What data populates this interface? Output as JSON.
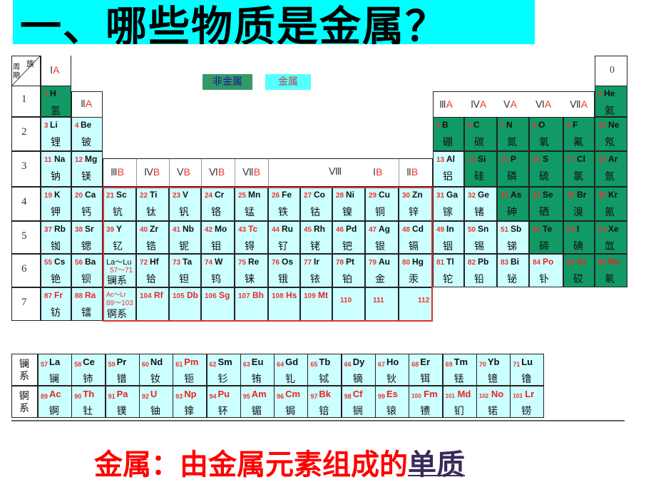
{
  "title": "一、哪些物质是金属？",
  "legend": {
    "nonmetal": "非金属",
    "metal": "金属"
  },
  "colors": {
    "nonmetal": "#119966",
    "metal": "#ccffff",
    "title_bg": "#00ffff",
    "footer": "#ff0000"
  },
  "header": {
    "group": "族",
    "period": "周期"
  },
  "groups_a": [
    {
      "roman": "Ⅰ",
      "suffix": "A"
    },
    {
      "roman": "Ⅱ",
      "suffix": "A"
    },
    {
      "roman": "Ⅲ",
      "suffix": "A"
    },
    {
      "roman": "Ⅳ",
      "suffix": "A"
    },
    {
      "roman": "Ⅴ",
      "suffix": "A"
    },
    {
      "roman": "Ⅵ",
      "suffix": "A"
    },
    {
      "roman": "Ⅶ",
      "suffix": "A"
    },
    {
      "roman": "0",
      "suffix": ""
    }
  ],
  "groups_b": [
    {
      "roman": "Ⅲ",
      "suffix": "B"
    },
    {
      "roman": "Ⅳ",
      "suffix": "B"
    },
    {
      "roman": "Ⅴ",
      "suffix": "B"
    },
    {
      "roman": "Ⅵ",
      "suffix": "B"
    },
    {
      "roman": "Ⅶ",
      "suffix": "B"
    },
    {
      "roman": "Ⅷ",
      "suffix": ""
    },
    {
      "roman": "Ⅰ",
      "suffix": "B"
    },
    {
      "roman": "Ⅱ",
      "suffix": "B"
    }
  ],
  "periods": [
    "1",
    "2",
    "3",
    "4",
    "5",
    "6",
    "7"
  ],
  "elements": [
    {
      "n": "1",
      "s": "H",
      "c": "氢",
      "p": 1,
      "g": 1,
      "nm": true
    },
    {
      "n": "2",
      "s": "He",
      "c": "氦",
      "p": 1,
      "g": 18,
      "nm": true
    },
    {
      "n": "3",
      "s": "Li",
      "c": "锂",
      "p": 2,
      "g": 1
    },
    {
      "n": "4",
      "s": "Be",
      "c": "铍",
      "p": 2,
      "g": 2
    },
    {
      "n": "5",
      "s": "B",
      "c": "硼",
      "p": 2,
      "g": 13,
      "nm": true
    },
    {
      "n": "6",
      "s": "C",
      "c": "碳",
      "p": 2,
      "g": 14,
      "nm": true
    },
    {
      "n": "7",
      "s": "N",
      "c": "氮",
      "p": 2,
      "g": 15,
      "nm": true
    },
    {
      "n": "8",
      "s": "O",
      "c": "氧",
      "p": 2,
      "g": 16,
      "nm": true
    },
    {
      "n": "9",
      "s": "F",
      "c": "氟",
      "p": 2,
      "g": 17,
      "nm": true
    },
    {
      "n": "10",
      "s": "Ne",
      "c": "氖",
      "p": 2,
      "g": 18,
      "nm": true
    },
    {
      "n": "11",
      "s": "Na",
      "c": "钠",
      "p": 3,
      "g": 1
    },
    {
      "n": "12",
      "s": "Mg",
      "c": "镁",
      "p": 3,
      "g": 2
    },
    {
      "n": "13",
      "s": "Al",
      "c": "铝",
      "p": 3,
      "g": 13
    },
    {
      "n": "14",
      "s": "Si",
      "c": "硅",
      "p": 3,
      "g": 14,
      "nm": true
    },
    {
      "n": "15",
      "s": "P",
      "c": "磷",
      "p": 3,
      "g": 15,
      "nm": true
    },
    {
      "n": "16",
      "s": "S",
      "c": "硫",
      "p": 3,
      "g": 16,
      "nm": true
    },
    {
      "n": "17",
      "s": "Cl",
      "c": "氯",
      "p": 3,
      "g": 17,
      "nm": true
    },
    {
      "n": "18",
      "s": "Ar",
      "c": "氩",
      "p": 3,
      "g": 18,
      "nm": true
    },
    {
      "n": "19",
      "s": "K",
      "c": "钾",
      "p": 4,
      "g": 1
    },
    {
      "n": "20",
      "s": "Ca",
      "c": "钙",
      "p": 4,
      "g": 2
    },
    {
      "n": "21",
      "s": "Sc",
      "c": "钪",
      "p": 4,
      "g": 3
    },
    {
      "n": "22",
      "s": "Ti",
      "c": "钛",
      "p": 4,
      "g": 4
    },
    {
      "n": "23",
      "s": "V",
      "c": "钒",
      "p": 4,
      "g": 5
    },
    {
      "n": "24",
      "s": "Cr",
      "c": "铬",
      "p": 4,
      "g": 6
    },
    {
      "n": "25",
      "s": "Mn",
      "c": "锰",
      "p": 4,
      "g": 7
    },
    {
      "n": "26",
      "s": "Fe",
      "c": "铁",
      "p": 4,
      "g": 8
    },
    {
      "n": "27",
      "s": "Co",
      "c": "钴",
      "p": 4,
      "g": 9
    },
    {
      "n": "28",
      "s": "Ni",
      "c": "镍",
      "p": 4,
      "g": 10
    },
    {
      "n": "29",
      "s": "Cu",
      "c": "铜",
      "p": 4,
      "g": 11
    },
    {
      "n": "30",
      "s": "Zn",
      "c": "锌",
      "p": 4,
      "g": 12
    },
    {
      "n": "31",
      "s": "Ga",
      "c": "镓",
      "p": 4,
      "g": 13
    },
    {
      "n": "32",
      "s": "Ge",
      "c": "锗",
      "p": 4,
      "g": 14
    },
    {
      "n": "33",
      "s": "As",
      "c": "砷",
      "p": 4,
      "g": 15,
      "nm": true
    },
    {
      "n": "34",
      "s": "Se",
      "c": "硒",
      "p": 4,
      "g": 16,
      "nm": true
    },
    {
      "n": "35",
      "s": "Br",
      "c": "溴",
      "p": 4,
      "g": 17,
      "nm": true
    },
    {
      "n": "36",
      "s": "Kr",
      "c": "氪",
      "p": 4,
      "g": 18,
      "nm": true
    },
    {
      "n": "37",
      "s": "Rb",
      "c": "铷",
      "p": 5,
      "g": 1
    },
    {
      "n": "38",
      "s": "Sr",
      "c": "锶",
      "p": 5,
      "g": 2
    },
    {
      "n": "39",
      "s": "Y",
      "c": "钇",
      "p": 5,
      "g": 3
    },
    {
      "n": "40",
      "s": "Zr",
      "c": "锆",
      "p": 5,
      "g": 4
    },
    {
      "n": "41",
      "s": "Nb",
      "c": "铌",
      "p": 5,
      "g": 5
    },
    {
      "n": "42",
      "s": "Mo",
      "c": "钼",
      "p": 5,
      "g": 6
    },
    {
      "n": "43",
      "s": "Tc",
      "c": "锝",
      "p": 5,
      "g": 7,
      "red": true
    },
    {
      "n": "44",
      "s": "Ru",
      "c": "钌",
      "p": 5,
      "g": 8
    },
    {
      "n": "45",
      "s": "Rh",
      "c": "铑",
      "p": 5,
      "g": 9
    },
    {
      "n": "46",
      "s": "Pd",
      "c": "钯",
      "p": 5,
      "g": 10
    },
    {
      "n": "47",
      "s": "Ag",
      "c": "银",
      "p": 5,
      "g": 11
    },
    {
      "n": "48",
      "s": "Cd",
      "c": "镉",
      "p": 5,
      "g": 12
    },
    {
      "n": "49",
      "s": "In",
      "c": "铟",
      "p": 5,
      "g": 13
    },
    {
      "n": "50",
      "s": "Sn",
      "c": "锡",
      "p": 5,
      "g": 14
    },
    {
      "n": "51",
      "s": "Sb",
      "c": "锑",
      "p": 5,
      "g": 15
    },
    {
      "n": "52",
      "s": "Te",
      "c": "碲",
      "p": 5,
      "g": 16,
      "nm": true
    },
    {
      "n": "53",
      "s": "I",
      "c": "碘",
      "p": 5,
      "g": 17,
      "nm": true
    },
    {
      "n": "54",
      "s": "Xe",
      "c": "氙",
      "p": 5,
      "g": 18,
      "nm": true
    },
    {
      "n": "55",
      "s": "Cs",
      "c": "铯",
      "p": 6,
      "g": 1
    },
    {
      "n": "56",
      "s": "Ba",
      "c": "钡",
      "p": 6,
      "g": 2
    },
    {
      "n": "57～71",
      "s": "La～Lu",
      "c": "镧系",
      "p": 6,
      "g": 3
    },
    {
      "n": "72",
      "s": "Hf",
      "c": "铪",
      "p": 6,
      "g": 4
    },
    {
      "n": "73",
      "s": "Ta",
      "c": "钽",
      "p": 6,
      "g": 5
    },
    {
      "n": "74",
      "s": "W",
      "c": "钨",
      "p": 6,
      "g": 6
    },
    {
      "n": "75",
      "s": "Re",
      "c": "铼",
      "p": 6,
      "g": 7
    },
    {
      "n": "76",
      "s": "Os",
      "c": "锇",
      "p": 6,
      "g": 8
    },
    {
      "n": "77",
      "s": "Ir",
      "c": "铱",
      "p": 6,
      "g": 9
    },
    {
      "n": "78",
      "s": "Pt",
      "c": "铂",
      "p": 6,
      "g": 10
    },
    {
      "n": "79",
      "s": "Au",
      "c": "金",
      "p": 6,
      "g": 11
    },
    {
      "n": "80",
      "s": "Hg",
      "c": "汞",
      "p": 6,
      "g": 12
    },
    {
      "n": "81",
      "s": "Tl",
      "c": "铊",
      "p": 6,
      "g": 13
    },
    {
      "n": "82",
      "s": "Pb",
      "c": "铅",
      "p": 6,
      "g": 14
    },
    {
      "n": "83",
      "s": "Bi",
      "c": "铋",
      "p": 6,
      "g": 15
    },
    {
      "n": "84",
      "s": "Po",
      "c": "钋",
      "p": 6,
      "g": 16,
      "red": true
    },
    {
      "n": "85",
      "s": "At",
      "c": "砹",
      "p": 6,
      "g": 17,
      "nm": true,
      "red": true
    },
    {
      "n": "86",
      "s": "Rn",
      "c": "氡",
      "p": 6,
      "g": 18,
      "nm": true,
      "red": true
    },
    {
      "n": "87",
      "s": "Fr",
      "c": "钫",
      "p": 7,
      "g": 1,
      "red": true
    },
    {
      "n": "88",
      "s": "Ra",
      "c": "镭",
      "p": 7,
      "g": 2,
      "red": true
    },
    {
      "n": "89～103",
      "s": "Ac～Lr",
      "c": "锕系",
      "p": 7,
      "g": 3,
      "red": true
    },
    {
      "n": "104",
      "s": "Rf",
      "c": "",
      "p": 7,
      "g": 4,
      "red": true
    },
    {
      "n": "105",
      "s": "Db",
      "c": "",
      "p": 7,
      "g": 5,
      "red": true
    },
    {
      "n": "106",
      "s": "Sg",
      "c": "",
      "p": 7,
      "g": 6,
      "red": true
    },
    {
      "n": "107",
      "s": "Bh",
      "c": "",
      "p": 7,
      "g": 7,
      "red": true
    },
    {
      "n": "108",
      "s": "Hs",
      "c": "",
      "p": 7,
      "g": 8,
      "red": true
    },
    {
      "n": "109",
      "s": "Mt",
      "c": "",
      "p": 7,
      "g": 9,
      "red": true
    },
    {
      "n": "110",
      "s": "",
      "c": "",
      "p": 7,
      "g": 10,
      "red": true
    },
    {
      "n": "111",
      "s": "",
      "c": "",
      "p": 7,
      "g": 11,
      "red": true
    },
    {
      "n": "112",
      "s": "",
      "c": "",
      "p": 7,
      "g": 12,
      "red": true
    }
  ],
  "series": [
    {
      "label": "镧系",
      "items": [
        {
          "n": "57",
          "s": "La",
          "c": "镧"
        },
        {
          "n": "58",
          "s": "Ce",
          "c": "铈"
        },
        {
          "n": "59",
          "s": "Pr",
          "c": "镨"
        },
        {
          "n": "60",
          "s": "Nd",
          "c": "钕"
        },
        {
          "n": "61",
          "s": "Pm",
          "c": "钷",
          "red": true
        },
        {
          "n": "62",
          "s": "Sm",
          "c": "钐"
        },
        {
          "n": "63",
          "s": "Eu",
          "c": "铕"
        },
        {
          "n": "64",
          "s": "Gd",
          "c": "钆"
        },
        {
          "n": "65",
          "s": "Tb",
          "c": "铽"
        },
        {
          "n": "66",
          "s": "Dy",
          "c": "镝"
        },
        {
          "n": "67",
          "s": "Ho",
          "c": "钬"
        },
        {
          "n": "68",
          "s": "Er",
          "c": "铒"
        },
        {
          "n": "69",
          "s": "Tm",
          "c": "铥"
        },
        {
          "n": "70",
          "s": "Yb",
          "c": "镱"
        },
        {
          "n": "71",
          "s": "Lu",
          "c": "镥"
        }
      ]
    },
    {
      "label": "锕系",
      "items": [
        {
          "n": "89",
          "s": "Ac",
          "c": "锕",
          "red": true
        },
        {
          "n": "90",
          "s": "Th",
          "c": "钍",
          "red": true
        },
        {
          "n": "91",
          "s": "Pa",
          "c": "镤",
          "red": true
        },
        {
          "n": "92",
          "s": "U",
          "c": "铀",
          "red": true
        },
        {
          "n": "93",
          "s": "Np",
          "c": "镎",
          "red": true
        },
        {
          "n": "94",
          "s": "Pu",
          "c": "钚",
          "red": true
        },
        {
          "n": "95",
          "s": "Am",
          "c": "镅",
          "red": true
        },
        {
          "n": "96",
          "s": "Cm",
          "c": "锔",
          "red": true
        },
        {
          "n": "97",
          "s": "Bk",
          "c": "锫",
          "red": true
        },
        {
          "n": "98",
          "s": "Cf",
          "c": "锎",
          "red": true
        },
        {
          "n": "99",
          "s": "Es",
          "c": "锿",
          "red": true
        },
        {
          "n": "100",
          "s": "Fm",
          "c": "镄",
          "red": true
        },
        {
          "n": "101",
          "s": "Md",
          "c": "钔",
          "red": true
        },
        {
          "n": "102",
          "s": "No",
          "c": "锘",
          "red": true
        },
        {
          "n": "103",
          "s": "Lr",
          "c": "铹",
          "red": true
        }
      ]
    }
  ],
  "footer": {
    "prefix": "金属：由金属元素组成的",
    "underlined": "单质"
  }
}
